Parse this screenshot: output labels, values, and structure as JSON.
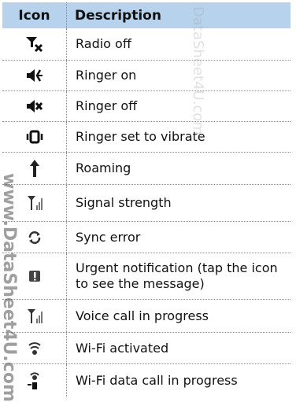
{
  "table": {
    "header": {
      "icon": "Icon",
      "description": "Description"
    },
    "rows": [
      {
        "icon": "radio-off-icon",
        "description": "Radio off"
      },
      {
        "icon": "ringer-on-icon",
        "description": "Ringer on"
      },
      {
        "icon": "ringer-off-icon",
        "description": "Ringer off"
      },
      {
        "icon": "vibrate-icon",
        "description": "Ringer set to vibrate"
      },
      {
        "icon": "roaming-icon",
        "description": "Roaming"
      },
      {
        "icon": "signal-strength-icon",
        "description": "Signal strength"
      },
      {
        "icon": "sync-error-icon",
        "description": "Sync error"
      },
      {
        "icon": "urgent-notification-icon",
        "description": "Urgent notification (tap the icon to see the message)"
      },
      {
        "icon": "voice-call-icon",
        "description": "Voice call in progress"
      },
      {
        "icon": "wifi-activated-icon",
        "description": "Wi-Fi activated"
      },
      {
        "icon": "wifi-data-call-icon",
        "description": "Wi-Fi data call in progress"
      }
    ]
  },
  "watermarks": {
    "side": "www.DataSheet4U.com",
    "faint": "DataSheet4U.com"
  },
  "colors": {
    "header_bg": "#b6d2ec"
  }
}
